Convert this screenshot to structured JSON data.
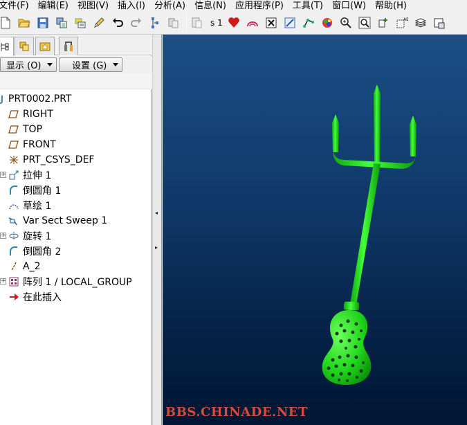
{
  "menu": {
    "items": [
      "文件(F)",
      "编辑(E)",
      "视图(V)",
      "插入(I)",
      "分析(A)",
      "信息(N)",
      "应用程序(P)",
      "工具(T)",
      "窗口(W)",
      "帮助(H)"
    ]
  },
  "toolbar": {
    "icons": [
      "new-file-icon",
      "open-folder-icon",
      "save-icon",
      "copy-icon",
      "print-icon",
      "edit-icon",
      "undo-icon",
      "redo-icon",
      "regenerate-icon",
      "paste-icon",
      "paste-special-icon",
      "heart-icon",
      "model-icon",
      "close-window-icon",
      "sketch-icon",
      "datum-icon",
      "appearance-icon",
      "zoom-in-icon",
      "zoom-fit-icon",
      "orient-icon",
      "view-manager-icon",
      "layers-icon",
      "box-icon"
    ],
    "text_item": "s 1"
  },
  "panel": {
    "tabs": [
      "model-tree-tab",
      "layer-tab",
      "favorites-tab",
      "tools-tab"
    ],
    "show_label": "显示 (O)",
    "settings_label": "设置 (G)"
  },
  "tree": {
    "root": "PRT0002.PRT",
    "items": [
      {
        "label": "RIGHT",
        "icon": "datum-plane-icon",
        "expandable": false
      },
      {
        "label": "TOP",
        "icon": "datum-plane-icon",
        "expandable": false
      },
      {
        "label": "FRONT",
        "icon": "datum-plane-icon",
        "expandable": false
      },
      {
        "label": "PRT_CSYS_DEF",
        "icon": "csys-icon",
        "expandable": false
      },
      {
        "label": "拉伸 1",
        "icon": "extrude-icon",
        "expandable": true
      },
      {
        "label": "倒圆角 1",
        "icon": "round-icon",
        "expandable": false
      },
      {
        "label": "草绘 1",
        "icon": "sketch-feature-icon",
        "expandable": false
      },
      {
        "label": "Var Sect Sweep 1",
        "icon": "sweep-icon",
        "expandable": false
      },
      {
        "label": "旋转 1",
        "icon": "revolve-icon",
        "expandable": true
      },
      {
        "label": "倒圆角 2",
        "icon": "round-icon",
        "expandable": false
      },
      {
        "label": "A_2",
        "icon": "axis-icon",
        "expandable": false
      },
      {
        "label": "阵列 1 / LOCAL_GROUP",
        "icon": "pattern-icon",
        "expandable": true
      },
      {
        "label": "在此插入",
        "icon": "insert-here-icon",
        "expandable": false
      }
    ]
  },
  "viewport": {
    "watermark": "BBS.CHINADE.NET",
    "model_color": "#22e01c",
    "background_top": "#1b4f86",
    "background_bottom": "#001633"
  }
}
